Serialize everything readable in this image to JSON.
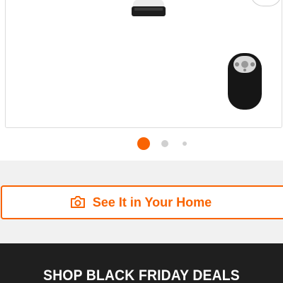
{
  "product_gallery": {
    "images": [
      {
        "icon": "ceiling-fan-light-icon"
      },
      {
        "icon": "fan-remote-control-icon"
      }
    ],
    "carousel": {
      "total_dots": 3,
      "active_index": 0
    }
  },
  "ar_button": {
    "label": "See It in Your Home",
    "icon": "camera-icon"
  },
  "promo_banner": {
    "text": "SHOP BLACK FRIDAY DEALS"
  },
  "colors": {
    "accent": "#f96302",
    "banner_bg": "#1f1f1f",
    "band_bg": "#f1f1f1",
    "dot_inactive": "#d0d0d0"
  }
}
